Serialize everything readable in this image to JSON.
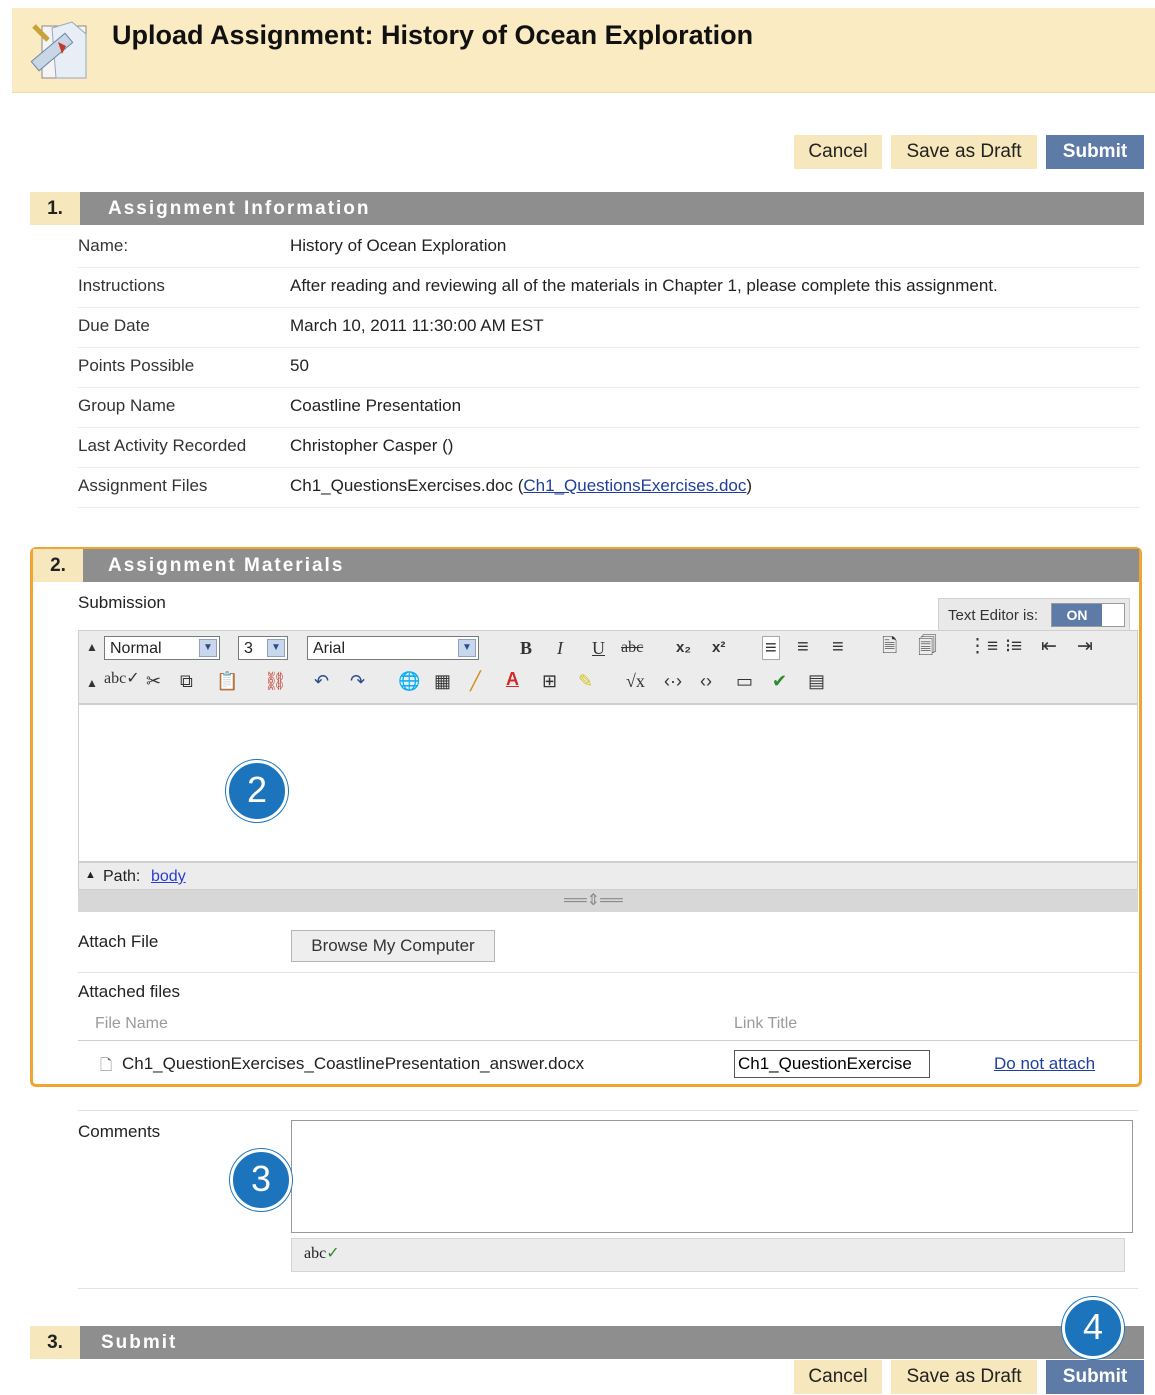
{
  "page": {
    "title": "Upload Assignment: History of Ocean Exploration"
  },
  "actions": {
    "cancel": "Cancel",
    "save_draft": "Save as Draft",
    "submit": "Submit"
  },
  "section1": {
    "number": "1.",
    "title": "Assignment Information",
    "rows": [
      {
        "label": "Name:",
        "value": "History of Ocean Exploration"
      },
      {
        "label": "Instructions",
        "value": "After reading and reviewing all of the materials in Chapter 1, please complete this assignment."
      },
      {
        "label": "Due Date",
        "value": "March 10, 2011 11:30:00 AM EST"
      },
      {
        "label": "Points Possible",
        "value": "50"
      },
      {
        "label": "Group Name",
        "value": "Coastline Presentation"
      },
      {
        "label": "Last Activity Recorded",
        "value": "Christopher Casper ()"
      },
      {
        "label": "Assignment Files",
        "value": "Ch1_QuestionsExercises.doc (",
        "link": "Ch1_QuestionsExercises.doc",
        "suffix": ")"
      }
    ]
  },
  "section2": {
    "number": "2.",
    "title": "Assignment Materials",
    "submission_label": "Submission",
    "text_editor": {
      "label": "Text Editor is:",
      "state": "ON"
    },
    "toolbar": {
      "format": "Normal",
      "size": "3",
      "font": "Arial"
    },
    "path_label": "Path:",
    "path_value": "body",
    "attach_file_label": "Attach File",
    "browse_button": "Browse My Computer",
    "attached_files_label": "Attached files",
    "columns": {
      "file_name": "File Name",
      "link_title": "Link Title"
    },
    "file": {
      "name": "Ch1_QuestionExercises_CoastlinePresentation_answer.docx",
      "link_title": "Ch1_QuestionExercise",
      "action": "Do not attach"
    }
  },
  "comments": {
    "label": "Comments",
    "spell_icon": "abc"
  },
  "section3": {
    "number": "3.",
    "title": "Submit"
  },
  "badges": {
    "b2": "2",
    "b3": "3",
    "b4": "4"
  }
}
